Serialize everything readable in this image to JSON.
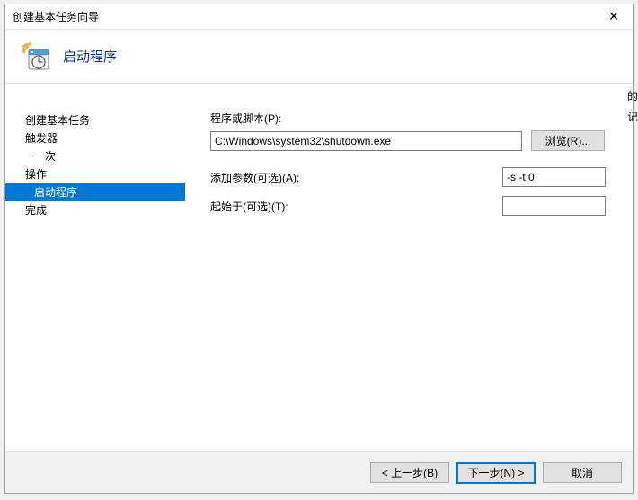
{
  "window": {
    "title": "创建基本任务向导"
  },
  "header": {
    "headline": "启动程序"
  },
  "sidebar": {
    "items": [
      {
        "label": "创建基本任务"
      },
      {
        "label": "触发器"
      },
      {
        "label": "一次"
      },
      {
        "label": "操作"
      },
      {
        "label": "启动程序"
      },
      {
        "label": "完成"
      }
    ]
  },
  "form": {
    "program_label": "程序或脚本(P):",
    "program_value": "C:\\Windows\\system32\\shutdown.exe",
    "browse_label": "浏览(R)...",
    "args_label": "添加参数(可选)(A):",
    "args_value": "-s -t 0",
    "startin_label": "起始于(可选)(T):",
    "startin_value": ""
  },
  "footer": {
    "back": "< 上一步(B)",
    "next": "下一步(N) >",
    "cancel": "取消"
  },
  "strip": {
    "l1": "的",
    "l2": "记"
  }
}
